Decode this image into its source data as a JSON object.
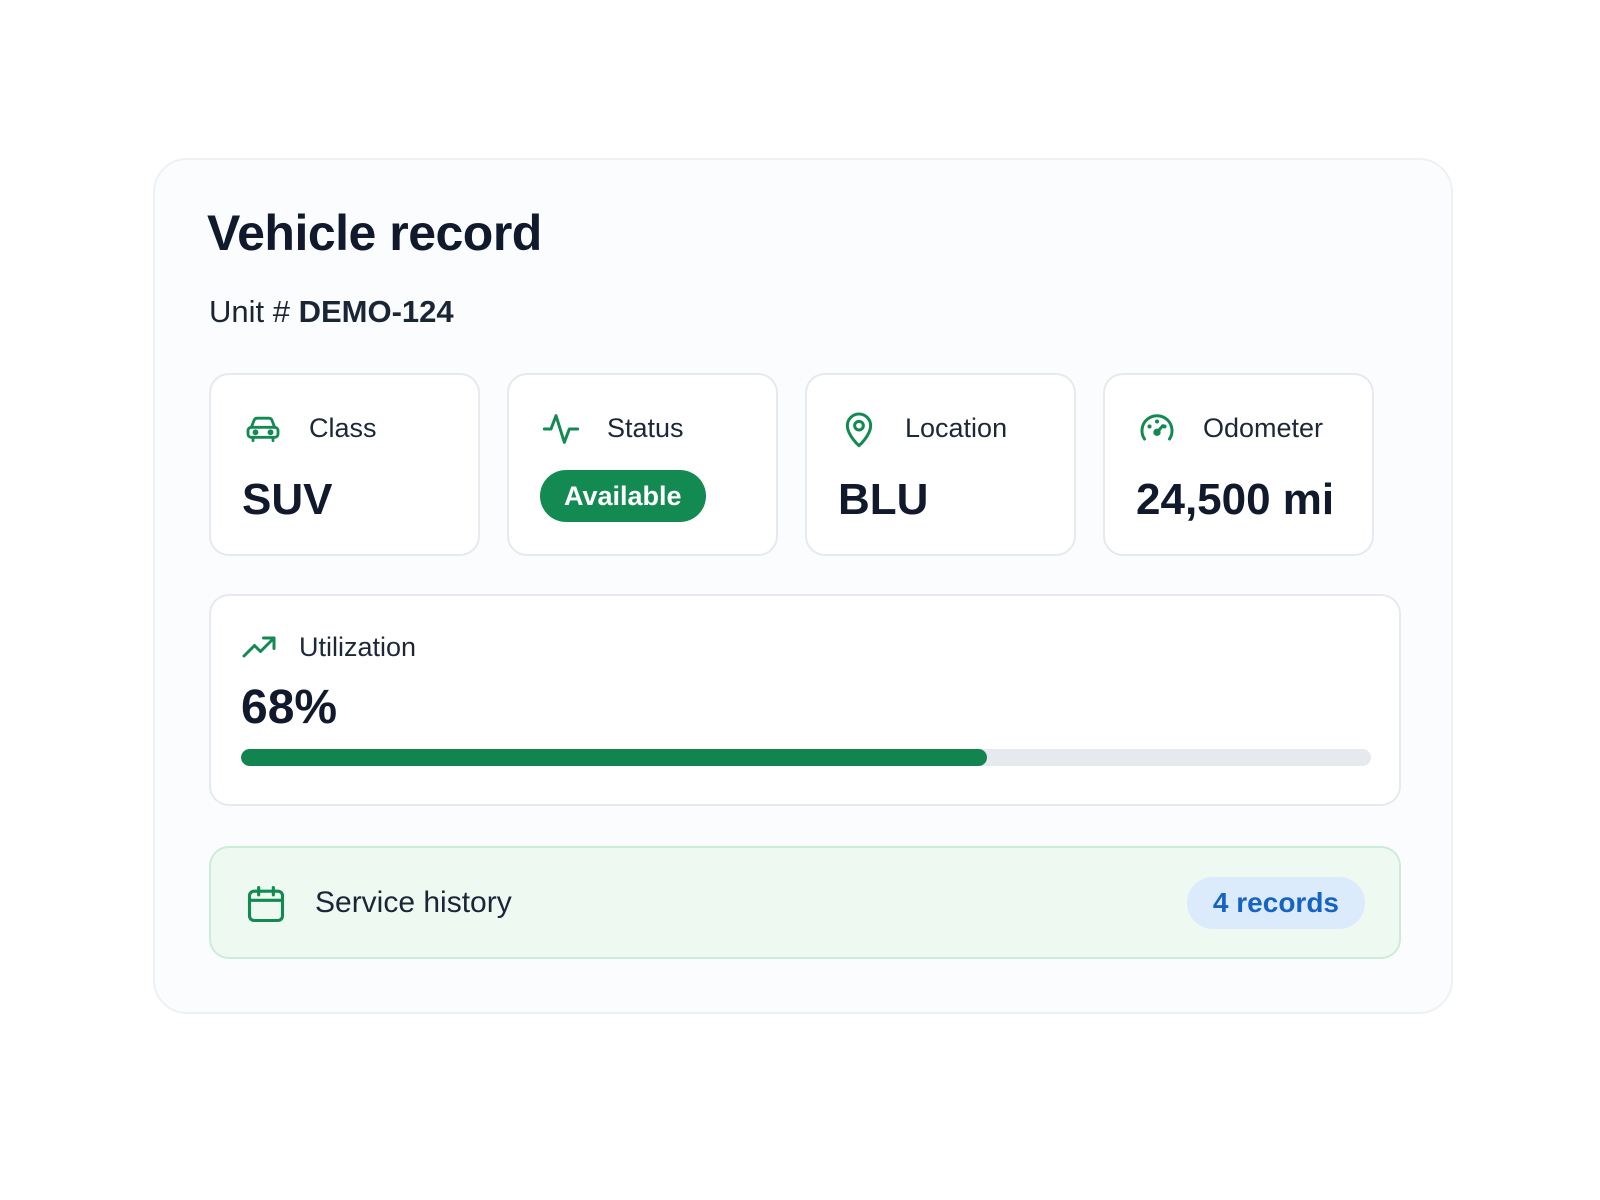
{
  "record": {
    "title": "Vehicle record",
    "unit_prefix": "Unit #",
    "unit_id": "DEMO-124"
  },
  "tiles": {
    "class": {
      "label": "Class",
      "value": "SUV",
      "icon": "car-icon"
    },
    "status": {
      "label": "Status",
      "value": "Available",
      "icon": "activity-icon"
    },
    "location": {
      "label": "Location",
      "value": "BLU",
      "icon": "map-pin-icon"
    },
    "odometer": {
      "label": "Odometer",
      "value": "24,500 mi",
      "icon": "gauge-icon"
    }
  },
  "utilization": {
    "label": "Utilization",
    "value": "68%",
    "fraction": 0.66,
    "icon": "trending-up-icon"
  },
  "service_history": {
    "label": "Service history",
    "count": "4 records",
    "icon": "calendar-icon"
  },
  "colors": {
    "accent_green": "#138a52",
    "progress_track": "#e6e9ee",
    "service_bg": "#eef9f2",
    "records_badge_bg": "#dcebfb",
    "records_badge_text": "#1663c4",
    "text_primary": "#101a2c"
  }
}
